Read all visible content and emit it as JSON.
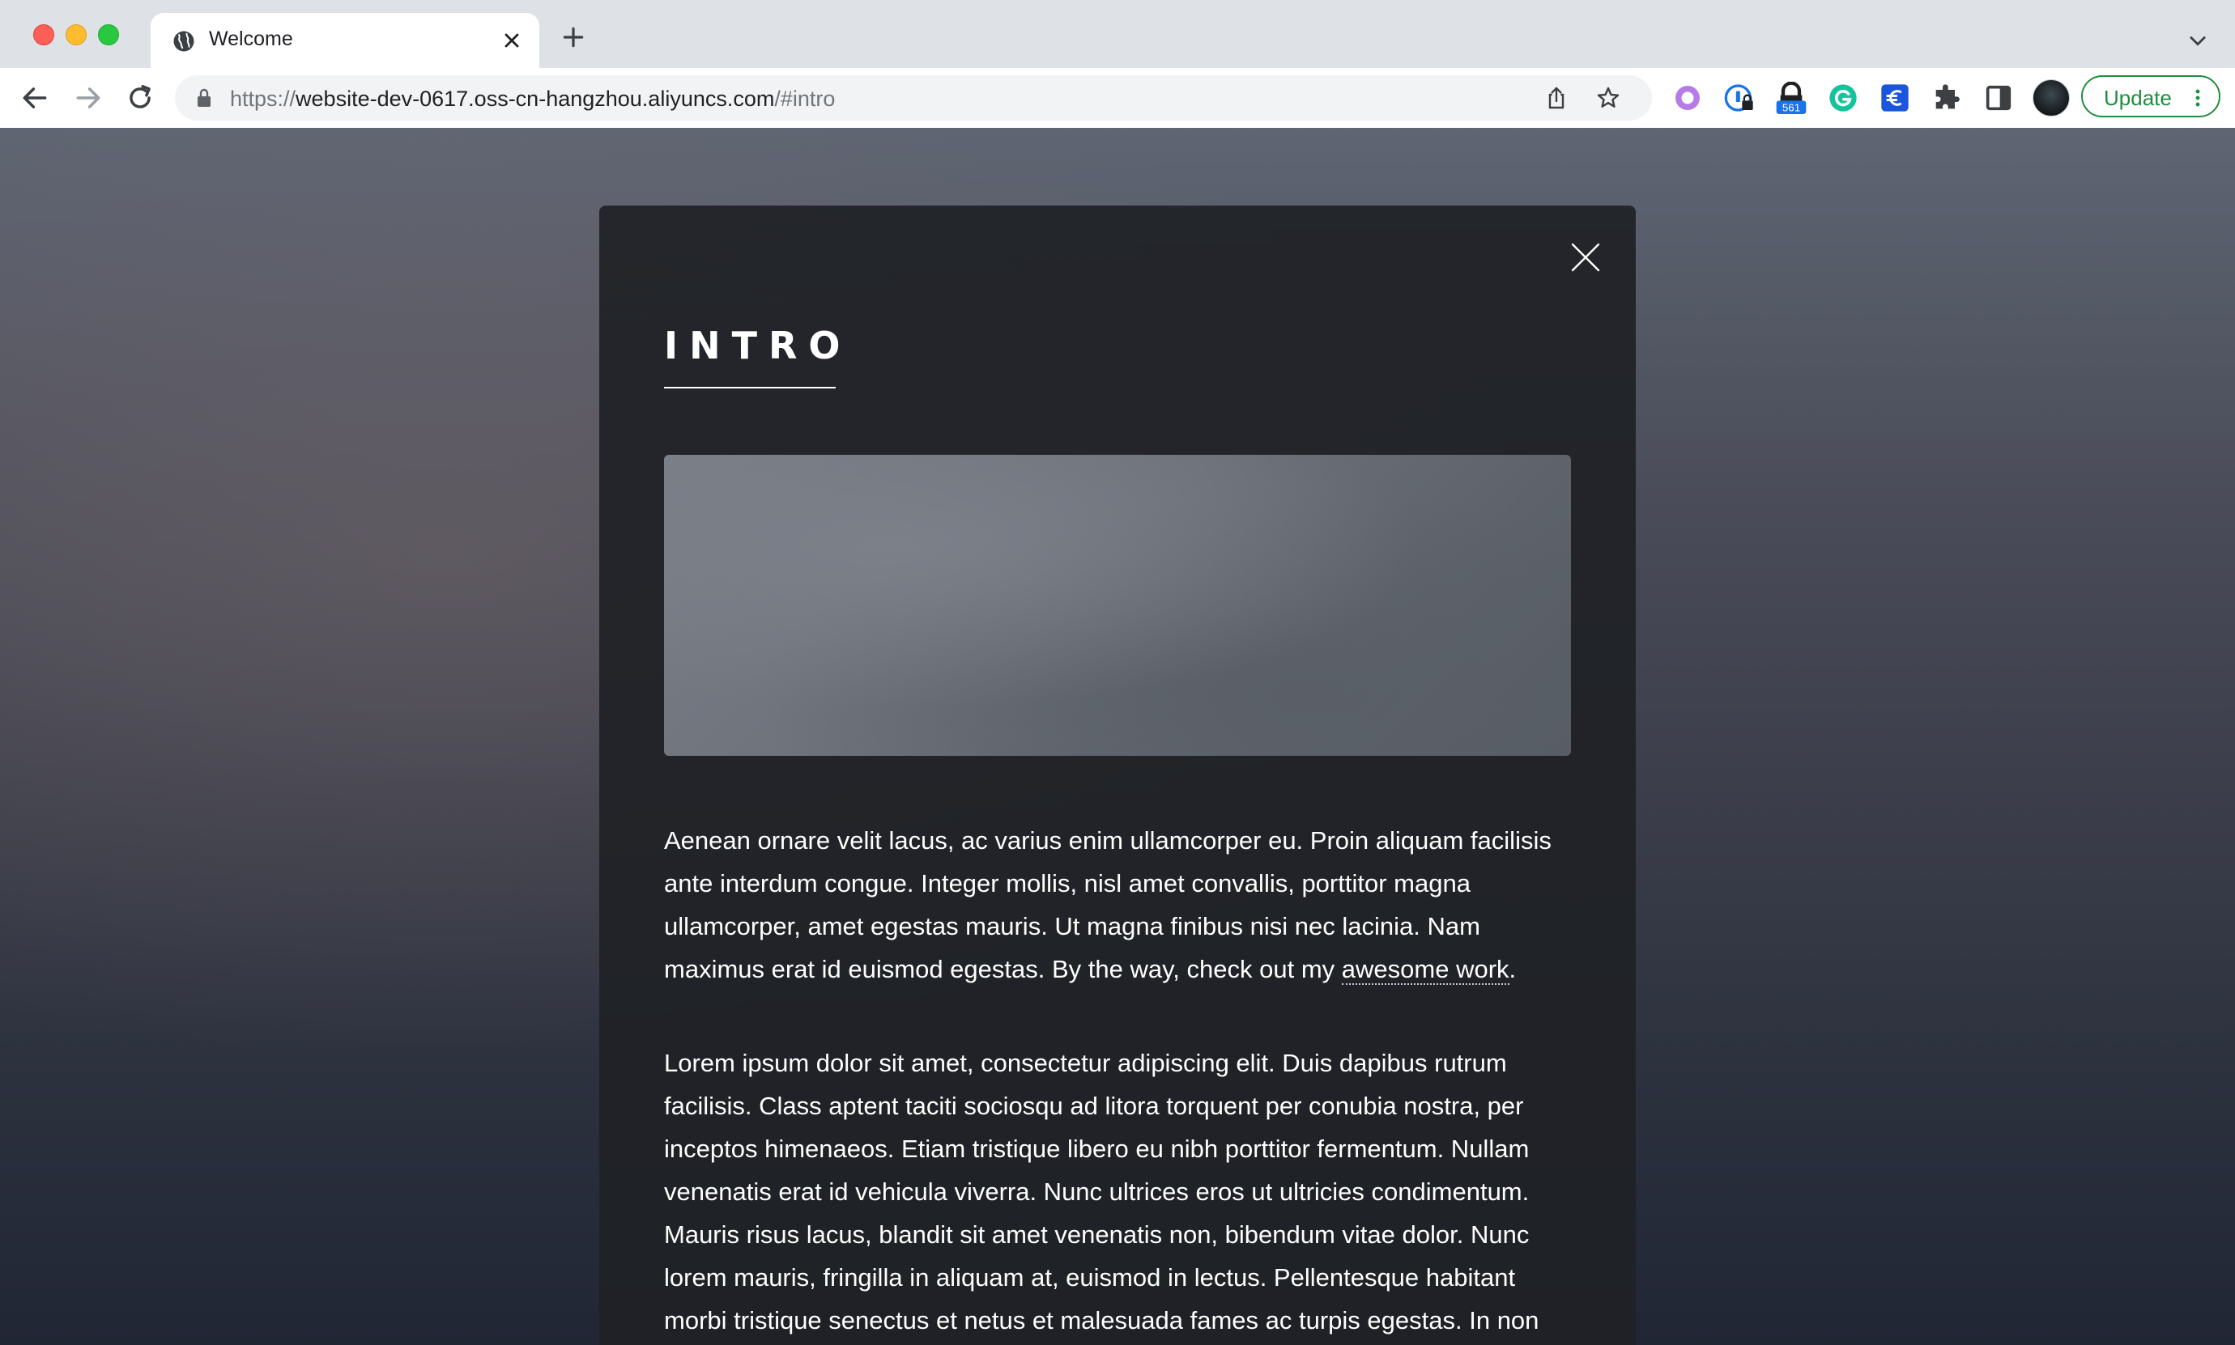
{
  "browser": {
    "tab": {
      "title": "Welcome",
      "favicon": "globe-icon"
    },
    "address_bar": {
      "scheme": "https://",
      "host": "website-dev-0617.oss-cn-hangzhou.aliyuncs.com",
      "path": "/#intro"
    },
    "extensions": [
      {
        "name": "circle-extension-icon",
        "color": "#b57be6"
      },
      {
        "name": "password-extension-icon",
        "color": "#1a73e8"
      },
      {
        "name": "lock-extension-icon",
        "badge": "561",
        "badge_color": "#1a73e8"
      },
      {
        "name": "grammarly-extension-icon",
        "color": "#15c39a"
      },
      {
        "name": "euro-extension-icon",
        "color": "#1a56db"
      },
      {
        "name": "puzzle-extensions-icon"
      },
      {
        "name": "side-panel-icon"
      }
    ],
    "update_button": {
      "label": "Update",
      "color": "#1e8e3e"
    }
  },
  "page": {
    "modal": {
      "title": "INTRO",
      "paragraph_1": {
        "text_before_link": "Aenean ornare velit lacus, ac varius enim ullamcorper eu. Proin aliquam facilisis ante interdum congue. Integer mollis, nisl amet convallis, porttitor magna ullamcorper, amet egestas mauris. Ut magna finibus nisi nec lacinia. Nam maximus erat id euismod egestas. By the way, check out my ",
        "link_text": "awesome work",
        "text_after_link": "."
      },
      "paragraph_2": "Lorem ipsum dolor sit amet, consectetur adipiscing elit. Duis dapibus rutrum facilisis. Class aptent taciti sociosqu ad litora torquent per conubia nostra, per inceptos himenaeos. Etiam tristique libero eu nibh porttitor fermentum. Nullam venenatis erat id vehicula viverra. Nunc ultrices eros ut ultricies condimentum. Mauris risus lacus, blandit sit amet venenatis non, bibendum vitae dolor. Nunc lorem mauris, fringilla in aliquam at, euismod in lectus. Pellentesque habitant morbi tristique senectus et netus et malesuada fames ac turpis egestas. In non lorem sit amet elit placerat maximus."
    }
  }
}
